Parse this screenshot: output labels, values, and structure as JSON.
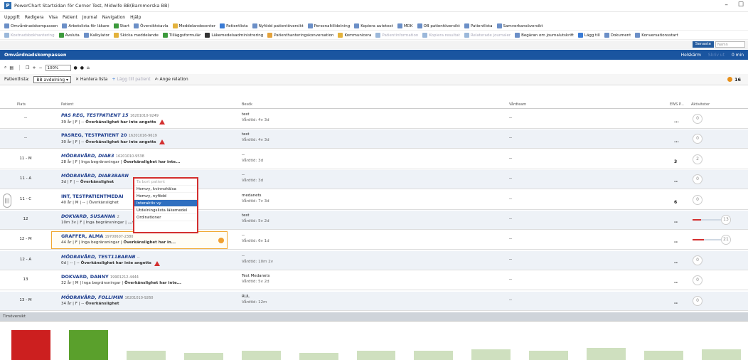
{
  "window": {
    "title": "PowerChart Startsidan för Cerner Test, Midwife BB(Barnmorska BB)",
    "controls": [
      "–",
      "☐"
    ]
  },
  "menu": [
    "Uppgift",
    "Redigera",
    "Visa",
    "Patient",
    "Journal",
    "Navigation",
    "Hjälp"
  ],
  "toolbar1": [
    {
      "label": "Omvårdnadskompassen",
      "color": "#6b8fc7",
      "disabled": false
    },
    {
      "label": "Arbetslista för läkare",
      "color": "#6b8fc7",
      "disabled": false
    },
    {
      "label": "Start",
      "color": "#3c9a3c",
      "disabled": false
    },
    {
      "label": "Översiktstavla",
      "color": "#6b8fc7",
      "disabled": false
    },
    {
      "label": "Meddelandecenter",
      "color": "#e3b23c",
      "disabled": false
    },
    {
      "label": "Patientlista",
      "color": "#3a7bd5",
      "disabled": false
    },
    {
      "label": "Nyfödd patientöversikt",
      "color": "#6b8fc7",
      "disabled": false
    },
    {
      "label": "Personaltilldelning",
      "color": "#6b8fc7",
      "disabled": false
    },
    {
      "label": "Kopiera autotext",
      "color": "#6b8fc7",
      "disabled": false
    },
    {
      "label": "MDK",
      "color": "#6b8fc7",
      "disabled": false
    },
    {
      "label": "OB patientöversikt",
      "color": "#6b8fc7",
      "disabled": false
    },
    {
      "label": "Patientlista",
      "color": "#6b8fc7",
      "disabled": false
    },
    {
      "label": "Samverkansöversikt",
      "color": "#6b8fc7",
      "disabled": false
    }
  ],
  "toolbar2": [
    {
      "label": "Kostnadsbokhantering",
      "color": "#9bb8da",
      "disabled": true
    },
    {
      "label": "Avsluta",
      "color": "#3c9a3c",
      "disabled": false
    },
    {
      "label": "Kalkylator",
      "color": "#6b8fc7",
      "disabled": false
    },
    {
      "label": "Skicka meddelande",
      "color": "#e3b23c",
      "disabled": false
    },
    {
      "label": "Tilläggsformulär",
      "color": "#3c9a3c",
      "disabled": false
    },
    {
      "label": "Läkemedelsadministrering",
      "color": "#333333",
      "disabled": false
    },
    {
      "label": "Patienthanteringskonversation",
      "color": "#e3a23c",
      "disabled": false
    },
    {
      "label": "Kommunicera",
      "color": "#e3b23c",
      "disabled": false
    },
    {
      "label": "Patientinformation",
      "color": "#9bb8da",
      "disabled": true
    },
    {
      "label": "Kopiera resultat",
      "color": "#9bb8da",
      "disabled": true
    },
    {
      "label": "Relaterade journaler",
      "color": "#9bb8da",
      "disabled": true
    },
    {
      "label": "Begäran om journalutskrift",
      "color": "#6b8fc7",
      "disabled": false
    },
    {
      "label": "Lägg till",
      "color": "#3a7bd5",
      "disabled": false
    },
    {
      "label": "Dokument",
      "color": "#6b8fc7",
      "disabled": false
    },
    {
      "label": "Konversationsstart",
      "color": "#6b8fc7",
      "disabled": false
    }
  ],
  "search": {
    "recent_label": "Senaste",
    "name_placeholder": "Namn"
  },
  "section": {
    "title": "Omvårdnadskompassen",
    "fullscreen": "Helskärm",
    "print": "Skriv ut",
    "refresh": "0 min"
  },
  "subtoolbar": {
    "zoom": "100%"
  },
  "listbar": {
    "label": "Patientlista:",
    "selected_list": "BB avdelning",
    "manage": "Hantera lista",
    "add_patient": "Lägg till patient",
    "relation": "Ange relation",
    "count": "16"
  },
  "columns": {
    "plats": "Plats",
    "patient": "Patient",
    "besok": "Besök",
    "vardteam": "Vårdteam",
    "ews": "EWS P...",
    "aktiviteter": "Aktiviteter"
  },
  "rows": [
    {
      "plats": "--",
      "name": "PAS REG, TESTPATIENT 15",
      "id": "16201010-9249",
      "details": "39 år | F | --",
      "warning": "Överkänslighet har inte angetts",
      "warn_icon": true,
      "besok1": "test",
      "besok2": "Vårdtid: 4v 3d",
      "vard": "--",
      "ews": "...",
      "akt": "0",
      "bar": null,
      "upright": false
    },
    {
      "plats": "--",
      "name": "PASREG, TESTPATIENT 20",
      "id": "16201016-9619",
      "details": "30 år | F | --",
      "warning": "Överkänslighet har inte angetts",
      "warn_icon": true,
      "besok1": "test",
      "besok2": "Vårdtid: 4v 3d",
      "vard": "--",
      "ews": "...",
      "akt": "0",
      "bar": null,
      "upright": true
    },
    {
      "plats": "11 - M",
      "name": "MÖDRAVÅRD, DIAB3",
      "id": "16201010-9538",
      "details": "28 år | F | Inga begränsningar |",
      "warning": "Överkänslighet har inte...",
      "warn_icon": false,
      "besok1": "--",
      "besok2": "Vårdtid: 3d",
      "vard": "--",
      "ews": "3",
      "akt": "2",
      "bar": null,
      "upright": false
    },
    {
      "plats": "11 - A",
      "name": "MÖDRAVÅRD, DIAB3BARN",
      "id": "",
      "details": "3d | F | --",
      "warning": "Överkänslighet",
      "warn_icon": false,
      "besok1": "--",
      "besok2": "Vårdtid: 3d",
      "vard": "--",
      "ews": "--",
      "akt": "0",
      "bar": null,
      "upright": false
    },
    {
      "plats": "11 - C",
      "name": "INT, TESTPATIENTMEDAI",
      "id": "",
      "details": "40 år | M | -- | Överkänslighet",
      "warning": "",
      "warn_icon": false,
      "besok1": "medanets",
      "besok2": "Vårdtid: 7v 3d",
      "vard": "--",
      "ews": "6",
      "akt": "0",
      "bar": null,
      "upright": true
    },
    {
      "plats": "12",
      "name": "DOKVARD, SUSANNA",
      "id": "2",
      "details": "10m 3v | F | Inga begränsningar |",
      "warning": "...t...",
      "warn_icon": false,
      "besok1": "test",
      "besok2": "Vårdtid: 5v 2d",
      "vard": "--",
      "ews": "--",
      "akt": "13",
      "bar": 0.3,
      "upright": false
    },
    {
      "plats": "12 - M",
      "name": "GRAFFER, ALMA",
      "id": "19700607-2380",
      "details": "44 år | F | Inga begränsningar |",
      "warning": "Överkänslighet har in...",
      "warn_icon": false,
      "besok1": "--",
      "besok2": "Vårdtid: 6v 1d",
      "vard": "--",
      "ews": "--",
      "akt": "21",
      "bar": 0.4,
      "upright": true
    },
    {
      "plats": "12 - A",
      "name": "MÖDRAVÅRD, TEST11BARNB",
      "id": "--",
      "details": "0d | -- | --",
      "warning": "Överkänslighet har inte angetts",
      "warn_icon": true,
      "besok1": "--",
      "besok2": "Vårdtid: 10m 2v",
      "vard": "--",
      "ews": "--",
      "akt": "0",
      "bar": null,
      "upright": false
    },
    {
      "plats": "13",
      "name": "DOKVARD, DANNY",
      "id": "19901212-4444",
      "details": "32 år | M | Inga begränsningar |",
      "warning": "Överkänslighet har inte...",
      "warn_icon": false,
      "besok1": "Test Medanets",
      "besok2": "Vårdtid: 5v 2d",
      "vard": "--",
      "ews": "--",
      "akt": "0",
      "bar": null,
      "upright": true
    },
    {
      "plats": "13 - M",
      "name": "MÖDRAVÅRD, FOLLIMIN",
      "id": "16201010-9260",
      "details": "34 år | F | --",
      "warning": "Överkänslighet",
      "warn_icon": false,
      "besok1": "RUL",
      "besok2": "Vårdtid: 12m",
      "vard": "--",
      "ews": "--",
      "akt": "0",
      "bar": null,
      "upright": false
    }
  ],
  "context_menu": {
    "items": [
      {
        "label": "Ta bort patient",
        "state": "disabled"
      },
      {
        "label": "Hemvy, kvinnohälsa",
        "state": "normal"
      },
      {
        "label": "Hemvy, nyfödd",
        "state": "normal"
      },
      {
        "label": "Interaktiv vy",
        "state": "selected"
      },
      {
        "label": "Utdelningslista läkemedel",
        "state": "normal"
      },
      {
        "label": "Ordinationer",
        "state": "normal"
      }
    ]
  },
  "timeline": {
    "header": "Timöversikt",
    "bars": [
      {
        "value": 1.0,
        "color": "#cc1f1f"
      },
      {
        "value": 1.0,
        "color": "#5aa02c"
      },
      {
        "value": 0.3,
        "color": "#cfe0bf"
      },
      {
        "value": 0.25,
        "color": "#cfe0bf"
      },
      {
        "value": 0.3,
        "color": "#cfe0bf"
      },
      {
        "value": 0.25,
        "color": "#cfe0bf"
      },
      {
        "value": 0.3,
        "color": "#cfe0bf"
      },
      {
        "value": 0.3,
        "color": "#cfe0bf"
      },
      {
        "value": 0.35,
        "color": "#cfe0bf"
      },
      {
        "value": 0.3,
        "color": "#cfe0bf"
      },
      {
        "value": 0.4,
        "color": "#cfe0bf"
      },
      {
        "value": 0.3,
        "color": "#cfe0bf"
      },
      {
        "value": 0.35,
        "color": "#cfe0bf"
      }
    ]
  }
}
